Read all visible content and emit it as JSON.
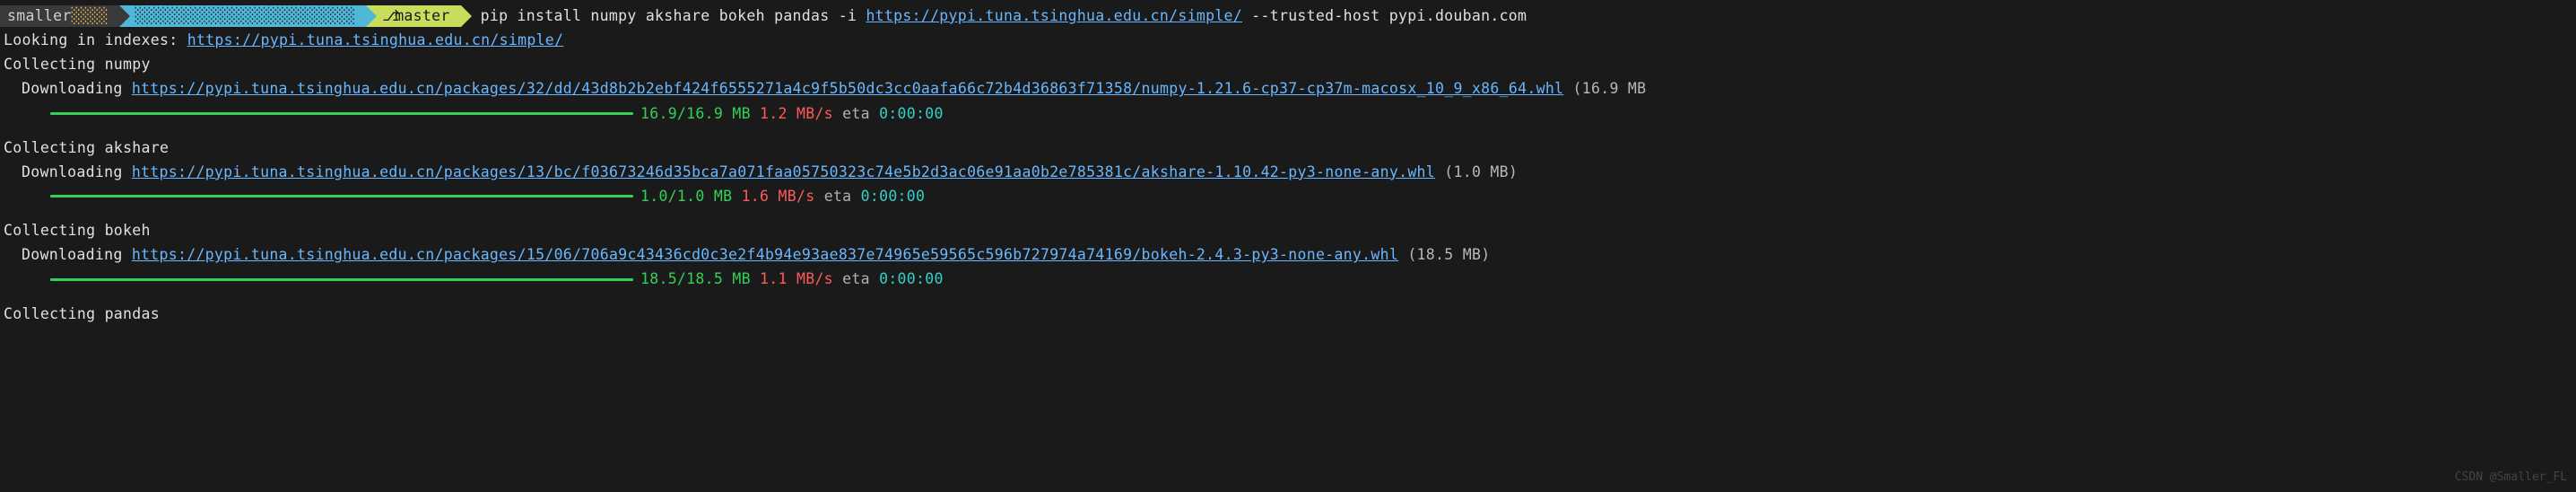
{
  "prompt": {
    "user": "smaller",
    "user_obscured": "░░░░",
    "path": "░░░░░░░░░░░░░░░░░░░░░░░░",
    "branch_icon": "⎇",
    "branch": "master",
    "command": "pip install numpy akshare bokeh pandas -i ",
    "index_url": "https://pypi.tuna.tsinghua.edu.cn/simple/",
    "command_tail": " --trusted-host pypi.douban.com"
  },
  "lines": {
    "lookup_prefix": "Looking in indexes: ",
    "lookup_url": "https://pypi.tuna.tsinghua.edu.cn/simple/",
    "collect_numpy": "Collecting numpy",
    "download_prefix": "Downloading ",
    "numpy_url": "https://pypi.tuna.tsinghua.edu.cn/packages/32/dd/43d8b2b2ebf424f6555271a4c9f5b50dc3cc0aafa66c72b4d36863f71358/numpy-1.21.6-cp37-cp37m-macosx_10_9_x86_64.whl",
    "numpy_size": " (16.9 MB",
    "collect_akshare": "Collecting akshare",
    "akshare_url": "https://pypi.tuna.tsinghua.edu.cn/packages/13/bc/f03673246d35bca7a071faa05750323c74e5b2d3ac06e91aa0b2e785381c/akshare-1.10.42-py3-none-any.whl",
    "akshare_size": " (1.0 MB)",
    "collect_bokeh": "Collecting bokeh",
    "bokeh_url": "https://pypi.tuna.tsinghua.edu.cn/packages/15/06/706a9c43436cd0c3e2f4b94e93ae837e74965e59565c596b727974a74169/bokeh-2.4.3-py3-none-any.whl",
    "bokeh_size": " (18.5 MB)",
    "collect_pandas": "Collecting pandas"
  },
  "progress": {
    "numpy": {
      "done": "16.9/16.9 MB",
      "speed": "1.2 MB/s",
      "eta_label": "eta",
      "eta": "0:00:00"
    },
    "akshare": {
      "done": "1.0/1.0 MB",
      "speed": "1.6 MB/s",
      "eta_label": "eta",
      "eta": "0:00:00"
    },
    "bokeh": {
      "done": "18.5/18.5 MB",
      "speed": "1.1 MB/s",
      "eta_label": "eta",
      "eta": "0:00:00"
    }
  },
  "watermark": "CSDN @Smaller_FL"
}
